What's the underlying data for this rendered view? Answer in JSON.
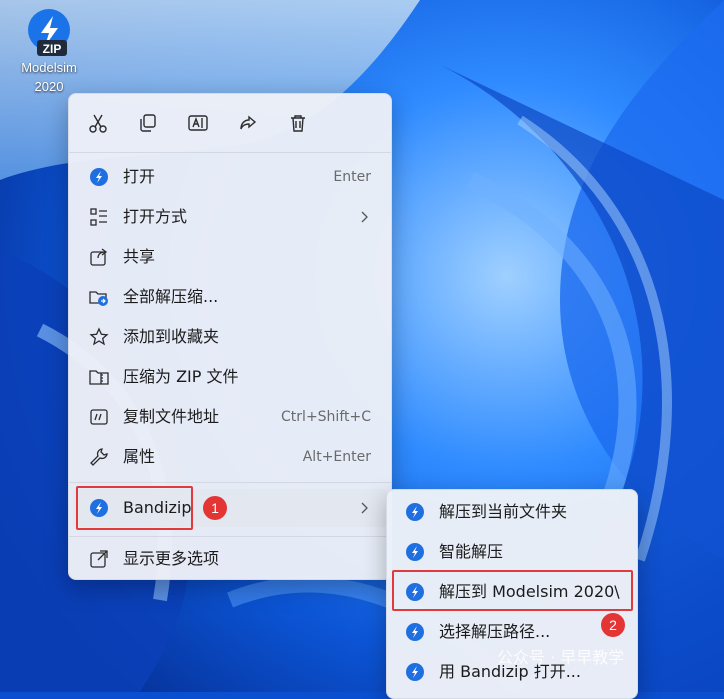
{
  "desktop": {
    "icon_name": "bandizip-archive-icon",
    "icon_badge_text": "ZIP",
    "label_line1": "Modelsim",
    "label_line2": "2020"
  },
  "context_menu": {
    "toolbar": [
      {
        "name": "cut-icon"
      },
      {
        "name": "copy-icon"
      },
      {
        "name": "rename-icon"
      },
      {
        "name": "share-icon"
      },
      {
        "name": "delete-icon"
      }
    ],
    "items": [
      {
        "label": "打开",
        "shortcut": "Enter"
      },
      {
        "label": "打开方式"
      },
      {
        "label": "共享"
      },
      {
        "label": "全部解压缩..."
      },
      {
        "label": "添加到收藏夹"
      },
      {
        "label": "压缩为 ZIP 文件"
      },
      {
        "label": "复制文件地址",
        "shortcut": "Ctrl+Shift+C"
      },
      {
        "label": "属性",
        "shortcut": "Alt+Enter"
      },
      {
        "label": "Bandizip"
      },
      {
        "label": "显示更多选项"
      }
    ]
  },
  "submenu": {
    "items": [
      {
        "label": "解压到当前文件夹"
      },
      {
        "label": "智能解压"
      },
      {
        "label": "解压到 Modelsim 2020\\"
      },
      {
        "label": "选择解压路径..."
      },
      {
        "label": "用 Bandizip 打开..."
      }
    ]
  },
  "annotations": {
    "step1": "1",
    "step2": "2",
    "highlight_color": "#e23a3a"
  },
  "watermark": "公众号 · 早早教学",
  "colors": {
    "accent": "#1f6fe0",
    "wallpaper": "#0a4fd0"
  }
}
